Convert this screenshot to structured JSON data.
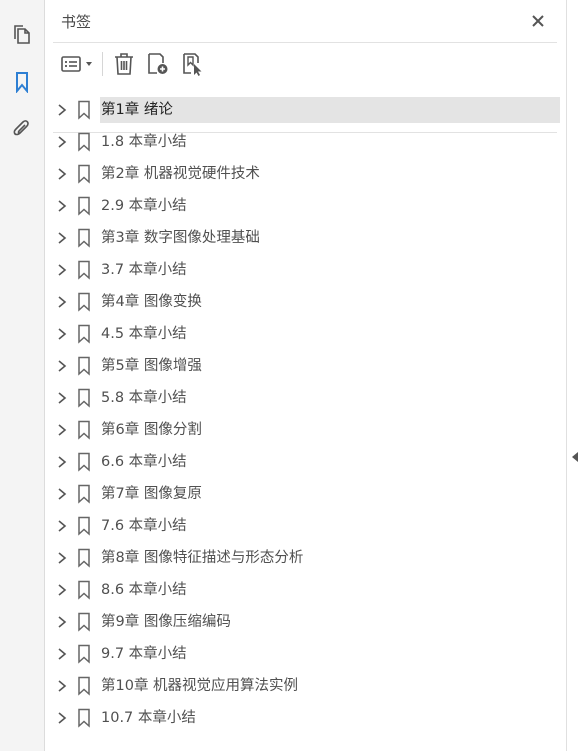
{
  "panel": {
    "title": "书签"
  },
  "rail": {
    "items": [
      {
        "icon": "pages-icon"
      },
      {
        "icon": "bookmark-icon"
      },
      {
        "icon": "attachment-icon"
      }
    ],
    "accent_color": "#2d7fd3"
  },
  "toolbar": {
    "buttons": [
      {
        "icon": "options-menu-icon"
      },
      {
        "icon": "trash-icon"
      },
      {
        "icon": "add-bookmark-icon"
      },
      {
        "icon": "bookmark-selection-icon"
      }
    ]
  },
  "bookmarks": [
    {
      "label": "第1章  绪论",
      "selected": true
    },
    {
      "label": "1.8  本章小结"
    },
    {
      "label": "第2章  机器视觉硬件技术"
    },
    {
      "label": "2.9  本章小结"
    },
    {
      "label": "第3章  数字图像处理基础"
    },
    {
      "label": "3.7  本章小结"
    },
    {
      "label": "第4章  图像变换"
    },
    {
      "label": "4.5  本章小结"
    },
    {
      "label": "第5章  图像增强"
    },
    {
      "label": "5.8  本章小结"
    },
    {
      "label": "第6章  图像分割"
    },
    {
      "label": "6.6  本章小结"
    },
    {
      "label": "第7章  图像复原"
    },
    {
      "label": "7.6  本章小结"
    },
    {
      "label": "第8章  图像特征描述与形态分析"
    },
    {
      "label": "8.6  本章小结"
    },
    {
      "label": "第9章  图像压缩编码"
    },
    {
      "label": "9.7  本章小结"
    },
    {
      "label": "第10章  机器视觉应用算法实例"
    },
    {
      "label": "10.7  本章小结"
    }
  ],
  "selected_bg": "#e4e4e4"
}
